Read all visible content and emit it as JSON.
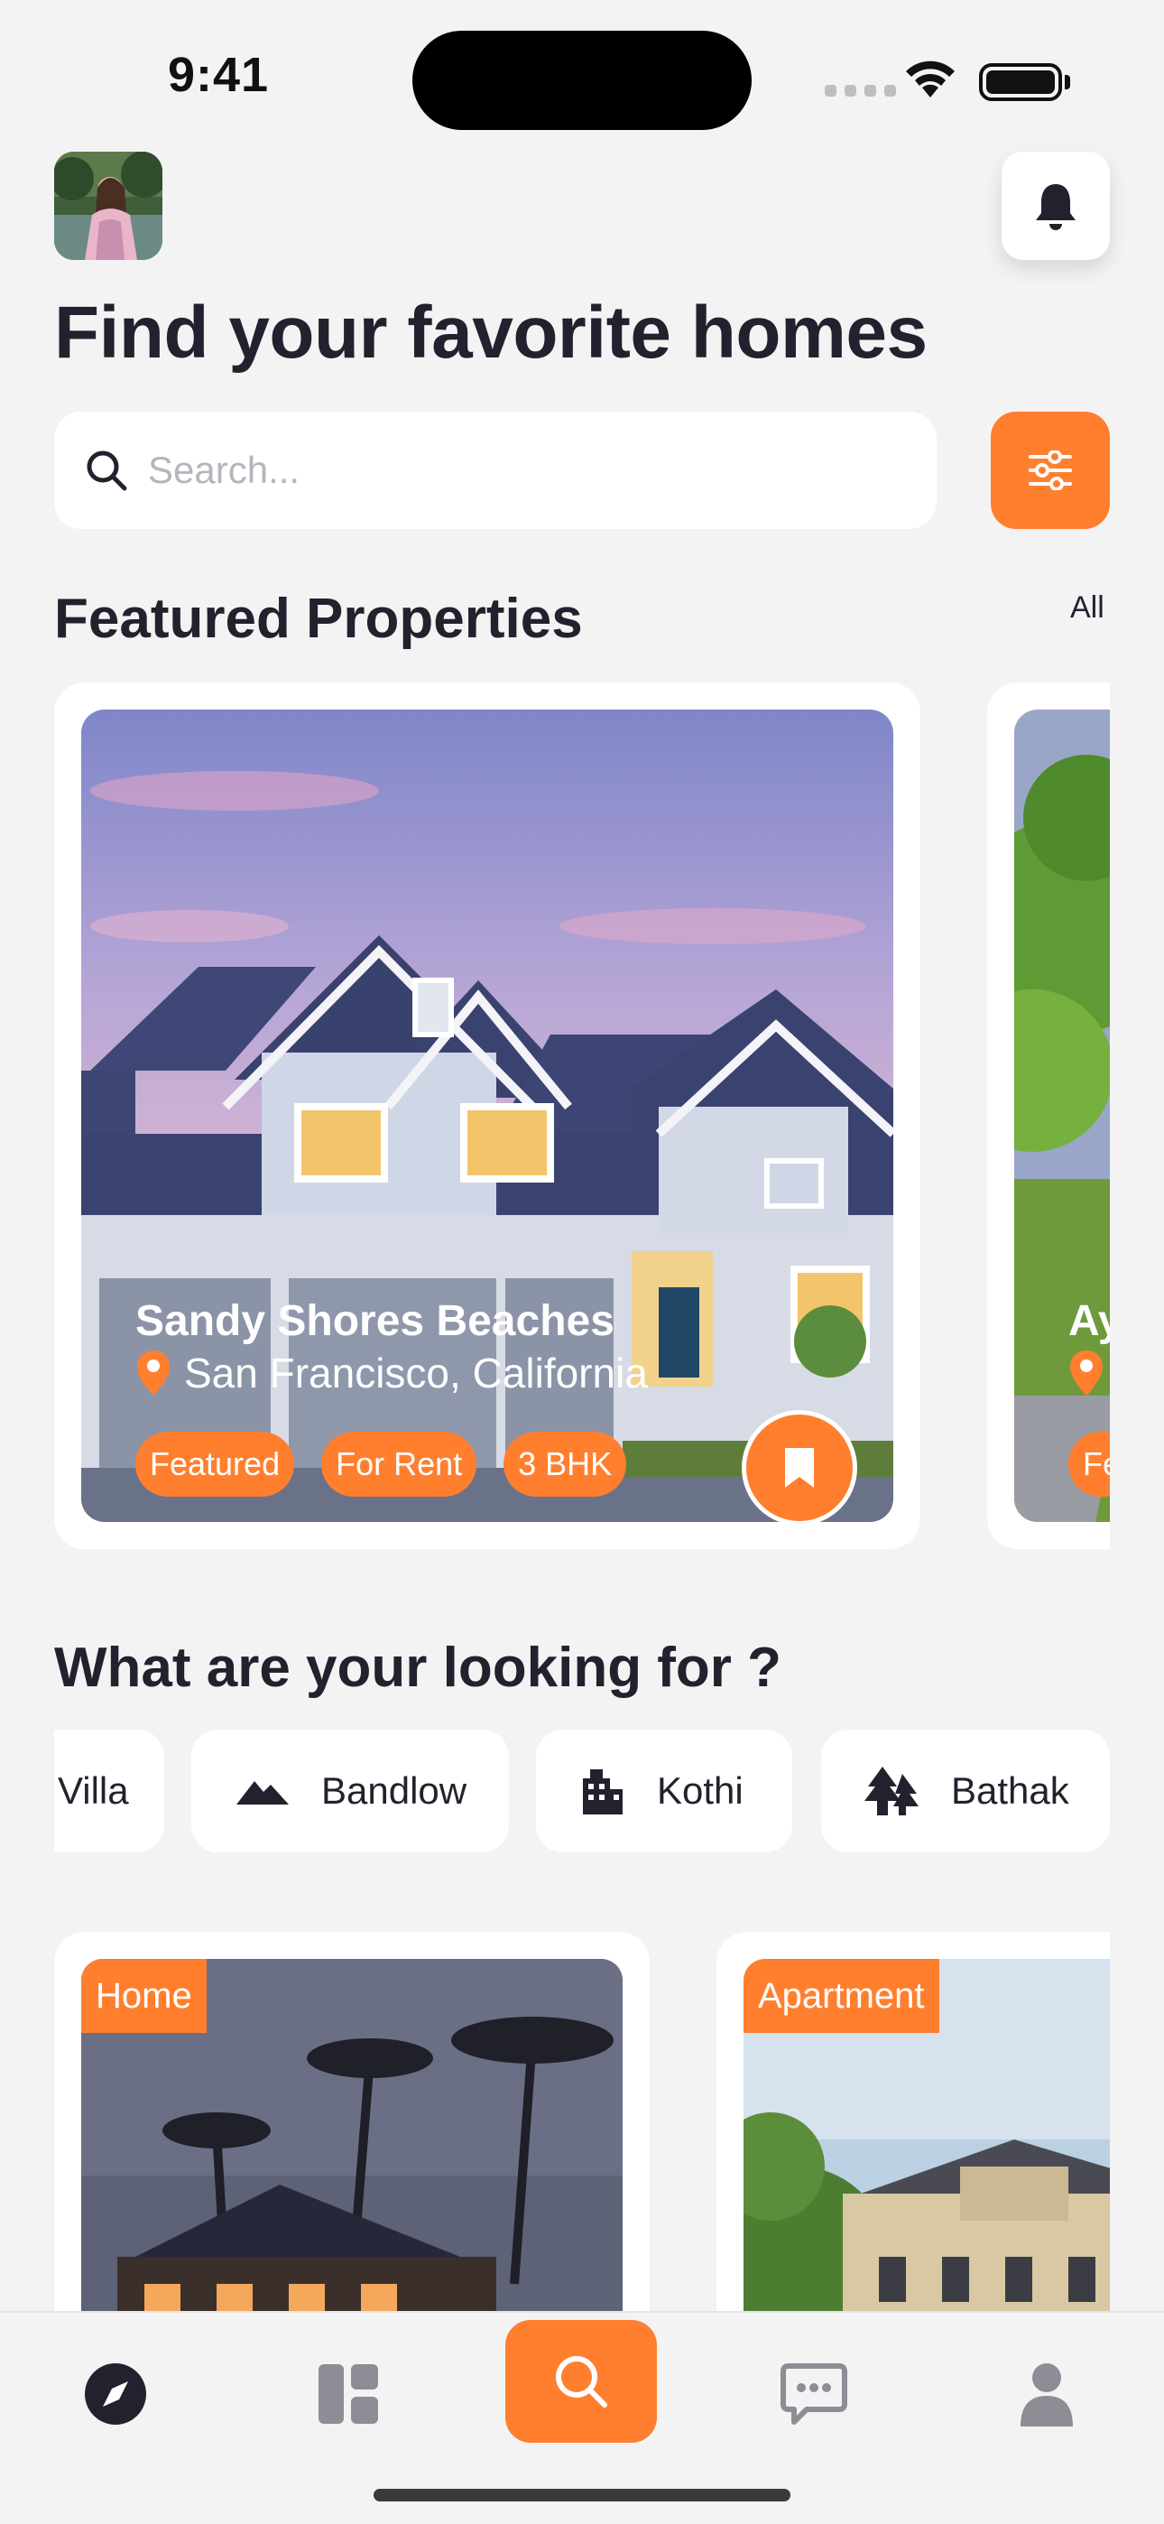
{
  "status_bar": {
    "time": "9:41"
  },
  "header": {
    "title": "Find your favorite homes",
    "search_placeholder": "Search..."
  },
  "featured": {
    "title": "Featured Properties",
    "see_all": "All",
    "cards": [
      {
        "name": "Sandy Shores Beaches",
        "location": "San Francisco, California",
        "tags": [
          "Featured",
          "For Rent",
          "3 BHK"
        ]
      },
      {
        "name": "Ay",
        "tag": "Fe"
      }
    ]
  },
  "categories": {
    "title": "What are your looking for ?",
    "items": [
      {
        "label": "Villa",
        "icon": "house-icon"
      },
      {
        "label": "Bandlow",
        "icon": "mountain-icon"
      },
      {
        "label": "Kothi",
        "icon": "building-icon"
      },
      {
        "label": "Bathak",
        "icon": "trees-icon"
      }
    ]
  },
  "property_types": [
    {
      "label": "Home"
    },
    {
      "label": "Apartment"
    }
  ],
  "tabbar": {
    "items": [
      "compass-icon",
      "dashboard-icon",
      "search-icon",
      "chat-icon",
      "profile-icon"
    ],
    "active": "search-icon"
  },
  "colors": {
    "accent": "#ff7f2f",
    "text": "#22222e",
    "background": "#f3f3f4"
  }
}
